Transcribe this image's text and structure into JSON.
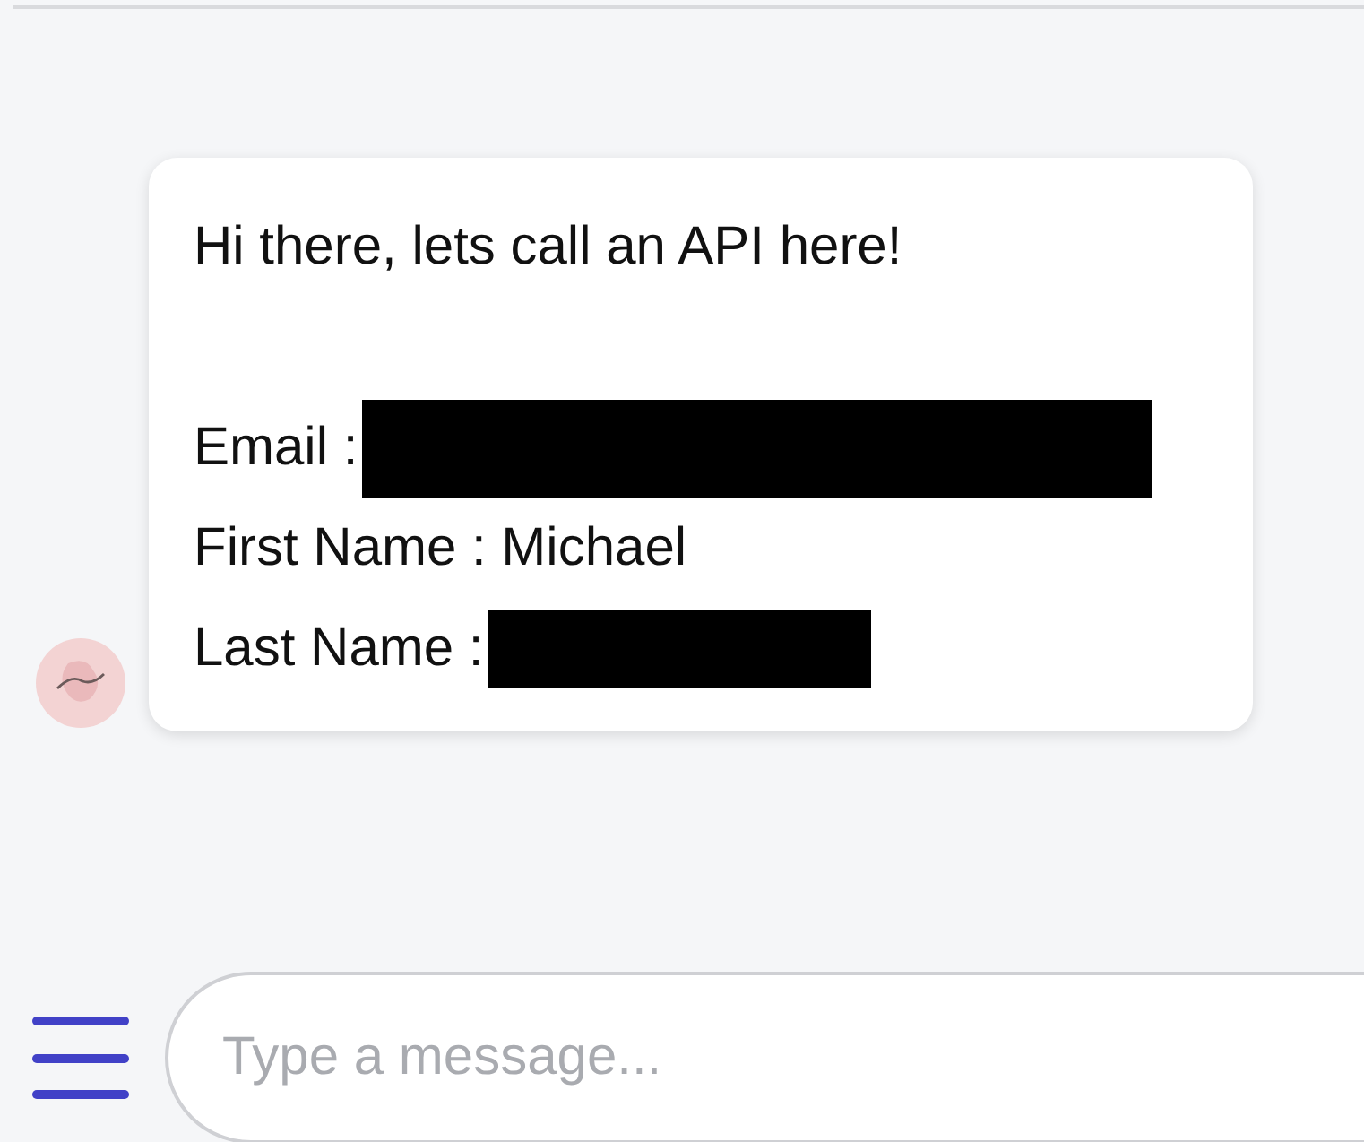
{
  "message": {
    "lines": [
      {
        "kind": "heading",
        "text": "Hi there, lets call an API here!"
      },
      {
        "kind": "redacted",
        "text": "Email :"
      },
      {
        "kind": "plain",
        "text": "First Name : Michael"
      },
      {
        "kind": "redacted",
        "text": "Last Name :"
      }
    ]
  },
  "composer": {
    "placeholder": "Type a message..."
  }
}
